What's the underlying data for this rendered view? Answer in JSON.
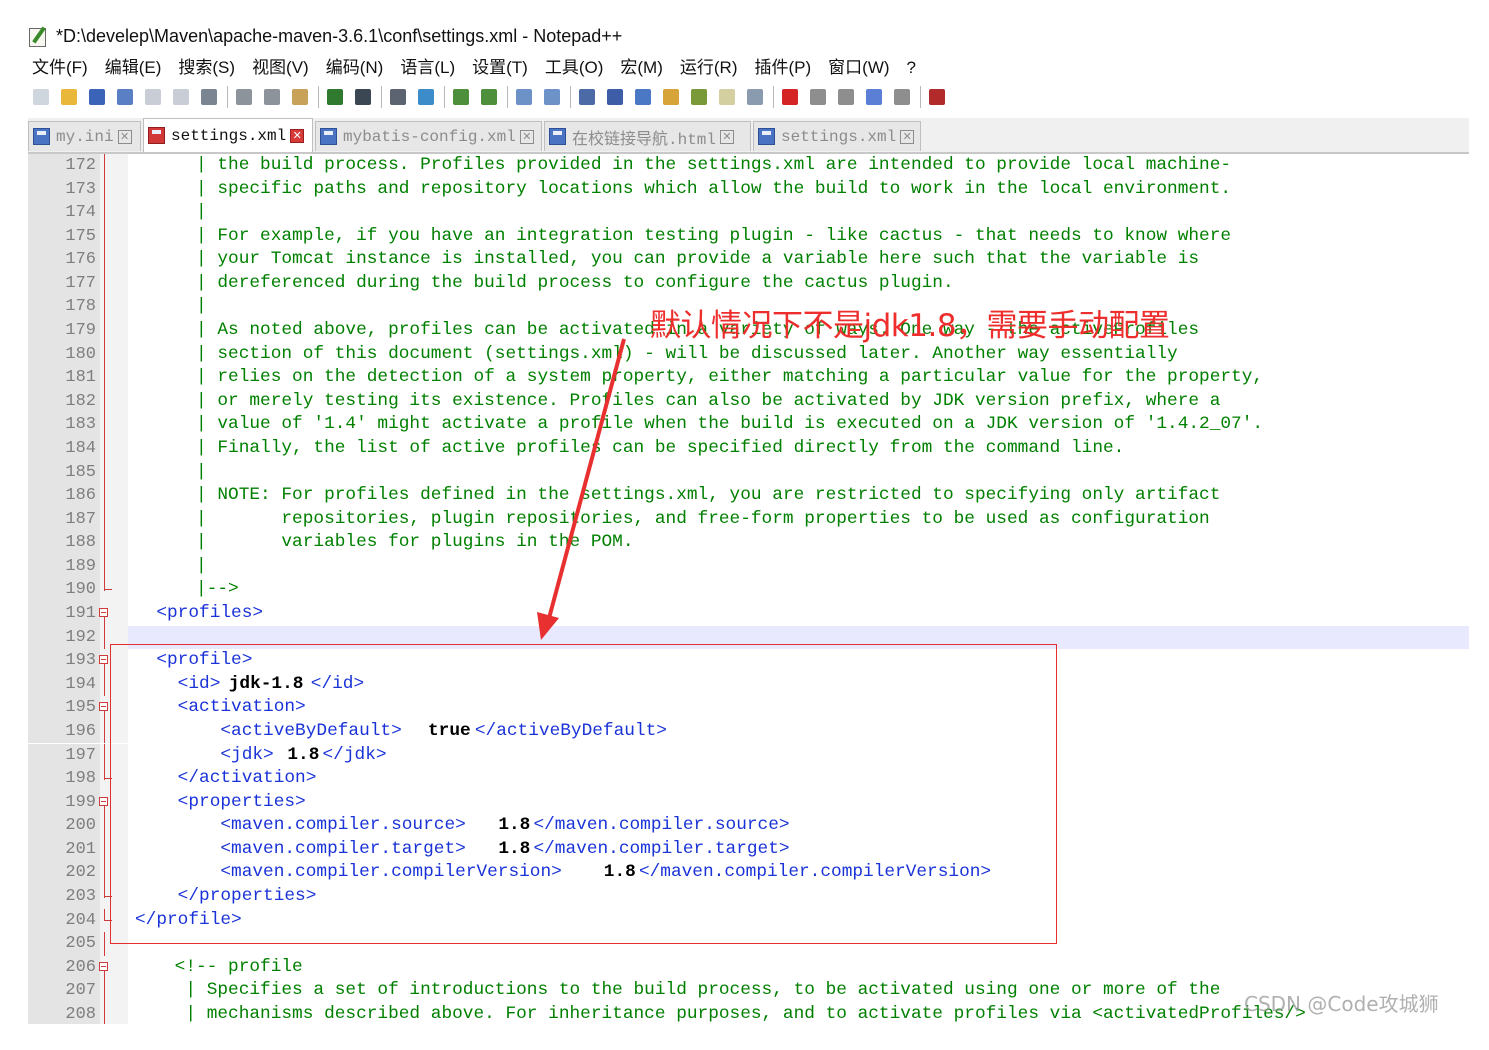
{
  "window": {
    "title": "*D:\\develep\\Maven\\apache-maven-3.6.1\\conf\\settings.xml - Notepad++"
  },
  "menu": [
    "文件(F)",
    "编辑(E)",
    "搜索(S)",
    "视图(V)",
    "编码(N)",
    "语言(L)",
    "设置(T)",
    "工具(O)",
    "宏(M)",
    "运行(R)",
    "插件(P)",
    "窗口(W)",
    "?"
  ],
  "toolbar": {
    "groups": [
      [
        "new-file-icon",
        "open-file-icon",
        "save-icon",
        "save-all-icon",
        "close-icon",
        "close-all-icon",
        "print-icon"
      ],
      [
        "cut-icon",
        "copy-icon",
        "paste-icon"
      ],
      [
        "undo-icon",
        "redo-icon"
      ],
      [
        "find-icon",
        "replace-icon"
      ],
      [
        "zoom-in-icon",
        "zoom-out-icon"
      ],
      [
        "sync-vertical-icon",
        "sync-horizontal-icon"
      ],
      [
        "word-wrap-icon",
        "show-all-chars-icon",
        "indent-guide-icon",
        "doc-map-icon",
        "function-list-icon",
        "folder-workspace-icon",
        "monitor-icon"
      ],
      [
        "record-macro-icon",
        "stop-record-icon",
        "play-macro-icon",
        "run-macro-multiple-icon",
        "save-macro-icon"
      ],
      [
        "spellcheck-icon"
      ]
    ],
    "colors": {
      "new-file-icon": "#cfd6de",
      "open-file-icon": "#e9b83a",
      "save-icon": "#3b64b8",
      "save-all-icon": "#5a7fc4",
      "close-icon": "#c9ced6",
      "close-all-icon": "#c9ced6",
      "print-icon": "#7b8592",
      "cut-icon": "#8d939b",
      "copy-icon": "#8d939b",
      "paste-icon": "#c9a25a",
      "undo-icon": "#2f7a2f",
      "redo-icon": "#3b4753",
      "find-icon": "#5b6470",
      "replace-icon": "#3b8cc8",
      "zoom-in-icon": "#4d8f3a",
      "zoom-out-icon": "#4d8f3a",
      "sync-vertical-icon": "#6c92c8",
      "sync-horizontal-icon": "#6c92c8",
      "word-wrap-icon": "#4c6aa6",
      "show-all-chars-icon": "#3d5ea7",
      "indent-guide-icon": "#4a78c4",
      "doc-map-icon": "#d7a43a",
      "function-list-icon": "#7a9a3a",
      "folder-workspace-icon": "#d4cfa0",
      "monitor-icon": "#8a9bb0",
      "record-macro-icon": "#d42424",
      "stop-record-icon": "#8e8e8e",
      "play-macro-icon": "#8e8e8e",
      "run-macro-multiple-icon": "#5b7fd4",
      "save-macro-icon": "#8e8e8e",
      "spellcheck-icon": "#b22a2a"
    }
  },
  "tabs": [
    {
      "label": "my.ini",
      "modified": false,
      "active": false
    },
    {
      "label": "settings.xml",
      "modified": true,
      "active": true
    },
    {
      "label": "mybatis-config.xml",
      "modified": false,
      "active": false
    },
    {
      "label": "在校链接导航.html",
      "modified": false,
      "active": false
    },
    {
      "label": "settings.xml",
      "modified": false,
      "active": false
    }
  ],
  "editor": {
    "current_line": "192",
    "lines": [
      {
        "num": "172",
        "fold": "bar",
        "kind": "comment",
        "text": "      | the build process. Profiles provided in the settings.xml are intended to provide local machine-"
      },
      {
        "num": "173",
        "fold": "bar",
        "kind": "comment",
        "text": "      | specific paths and repository locations which allow the build to work in the local environment."
      },
      {
        "num": "174",
        "fold": "bar",
        "kind": "comment",
        "text": "      |"
      },
      {
        "num": "175",
        "fold": "bar",
        "kind": "comment",
        "text": "      | For example, if you have an integration testing plugin - like cactus - that needs to know where"
      },
      {
        "num": "176",
        "fold": "bar",
        "kind": "comment",
        "text": "      | your Tomcat instance is installed, you can provide a variable here such that the variable is"
      },
      {
        "num": "177",
        "fold": "bar",
        "kind": "comment",
        "text": "      | dereferenced during the build process to configure the cactus plugin."
      },
      {
        "num": "178",
        "fold": "bar",
        "kind": "comment",
        "text": "      |"
      },
      {
        "num": "179",
        "fold": "bar",
        "kind": "comment",
        "text": "      | As noted above, profiles can be activated in a variety of ways. One way - the activeProfiles"
      },
      {
        "num": "180",
        "fold": "bar",
        "kind": "comment",
        "text": "      | section of this document (settings.xml) - will be discussed later. Another way essentially"
      },
      {
        "num": "181",
        "fold": "bar",
        "kind": "comment",
        "text": "      | relies on the detection of a system property, either matching a particular value for the property,"
      },
      {
        "num": "182",
        "fold": "bar",
        "kind": "comment",
        "text": "      | or merely testing its existence. Profiles can also be activated by JDK version prefix, where a"
      },
      {
        "num": "183",
        "fold": "bar",
        "kind": "comment",
        "text": "      | value of '1.4' might activate a profile when the build is executed on a JDK version of '1.4.2_07'."
      },
      {
        "num": "184",
        "fold": "bar",
        "kind": "comment",
        "text": "      | Finally, the list of active profiles can be specified directly from the command line."
      },
      {
        "num": "185",
        "fold": "bar",
        "kind": "comment",
        "text": "      |"
      },
      {
        "num": "186",
        "fold": "bar",
        "kind": "comment",
        "text": "      | NOTE: For profiles defined in the settings.xml, you are restricted to specifying only artifact"
      },
      {
        "num": "187",
        "fold": "bar",
        "kind": "comment",
        "text": "      |       repositories, plugin repositories, and free-form properties to be used as configuration"
      },
      {
        "num": "188",
        "fold": "bar",
        "kind": "comment",
        "text": "      |       variables for plugins in the POM."
      },
      {
        "num": "189",
        "fold": "bar",
        "kind": "comment",
        "text": "      |"
      },
      {
        "num": "190",
        "fold": "end",
        "kind": "comment",
        "text": "      |-->"
      },
      {
        "num": "191",
        "fold": "box",
        "kind": "xml",
        "segments": [
          {
            "t": "  <profiles>",
            "c": "xml"
          }
        ]
      },
      {
        "num": "192",
        "fold": "bar",
        "kind": "xml",
        "segments": [
          {
            "t": "",
            "c": "xml"
          }
        ]
      },
      {
        "num": "193",
        "fold": "box",
        "kind": "xml",
        "segments": [
          {
            "t": "  <profile>",
            "c": "xml"
          }
        ]
      },
      {
        "num": "194",
        "fold": "bar",
        "kind": "xml",
        "segments": [
          {
            "t": "    <id>",
            "c": "xml"
          },
          {
            "t": "jdk-1.8",
            "c": "val"
          },
          {
            "t": "</id>",
            "c": "xml"
          }
        ]
      },
      {
        "num": "195",
        "fold": "box",
        "kind": "xml",
        "segments": [
          {
            "t": "    <activation>",
            "c": "xml"
          }
        ]
      },
      {
        "num": "196",
        "fold": "bar",
        "kind": "xml",
        "segments": [
          {
            "t": "        <activeByDefault>",
            "c": "xml"
          },
          {
            "t": "true",
            "c": "val"
          },
          {
            "t": "</activeByDefault>",
            "c": "xml"
          }
        ]
      },
      {
        "num": "197",
        "fold": "bar",
        "kind": "xml",
        "segments": [
          {
            "t": "        <jdk>",
            "c": "xml"
          },
          {
            "t": "1.8",
            "c": "val"
          },
          {
            "t": "</jdk>",
            "c": "xml"
          }
        ]
      },
      {
        "num": "198",
        "fold": "end",
        "kind": "xml",
        "segments": [
          {
            "t": "    </activation>",
            "c": "xml"
          }
        ]
      },
      {
        "num": "199",
        "fold": "box",
        "kind": "xml",
        "segments": [
          {
            "t": "    <properties>",
            "c": "xml"
          }
        ]
      },
      {
        "num": "200",
        "fold": "bar",
        "kind": "xml",
        "segments": [
          {
            "t": "        <maven.compiler.source>",
            "c": "xml"
          },
          {
            "t": "1.8",
            "c": "val"
          },
          {
            "t": "</maven.compiler.source>",
            "c": "xml"
          }
        ]
      },
      {
        "num": "201",
        "fold": "bar",
        "kind": "xml",
        "segments": [
          {
            "t": "        <maven.compiler.target>",
            "c": "xml"
          },
          {
            "t": "1.8",
            "c": "val"
          },
          {
            "t": "</maven.compiler.target>",
            "c": "xml"
          }
        ]
      },
      {
        "num": "202",
        "fold": "bar",
        "kind": "xml",
        "segments": [
          {
            "t": "        <maven.compiler.compilerVersion>",
            "c": "xml"
          },
          {
            "t": "1.8",
            "c": "val"
          },
          {
            "t": "</maven.compiler.compilerVersion>",
            "c": "xml"
          }
        ]
      },
      {
        "num": "203",
        "fold": "end",
        "kind": "xml",
        "segments": [
          {
            "t": "    </properties>",
            "c": "xml"
          }
        ]
      },
      {
        "num": "204",
        "fold": "end",
        "kind": "xml",
        "segments": [
          {
            "t": "</profile>",
            "c": "xml"
          }
        ]
      },
      {
        "num": "205",
        "fold": "bar",
        "kind": "xml",
        "segments": [
          {
            "t": "",
            "c": "xml"
          }
        ]
      },
      {
        "num": "206",
        "fold": "box",
        "kind": "comment",
        "text": "    <!-- profile"
      },
      {
        "num": "207",
        "fold": "bar",
        "kind": "comment",
        "text": "     | Specifies a set of introductions to the build process, to be activated using one or more of the"
      },
      {
        "num": "208",
        "fold": "bar",
        "kind": "comment",
        "text": "     | mechanisms described above. For inheritance purposes, and to activate profiles via <activatedProfiles/>"
      }
    ]
  },
  "annotation": {
    "text": "默认情况下不是jdk1.8，需要手动配置",
    "color": "#ee2d2d"
  },
  "watermark": "CSDN @Code攻城狮"
}
